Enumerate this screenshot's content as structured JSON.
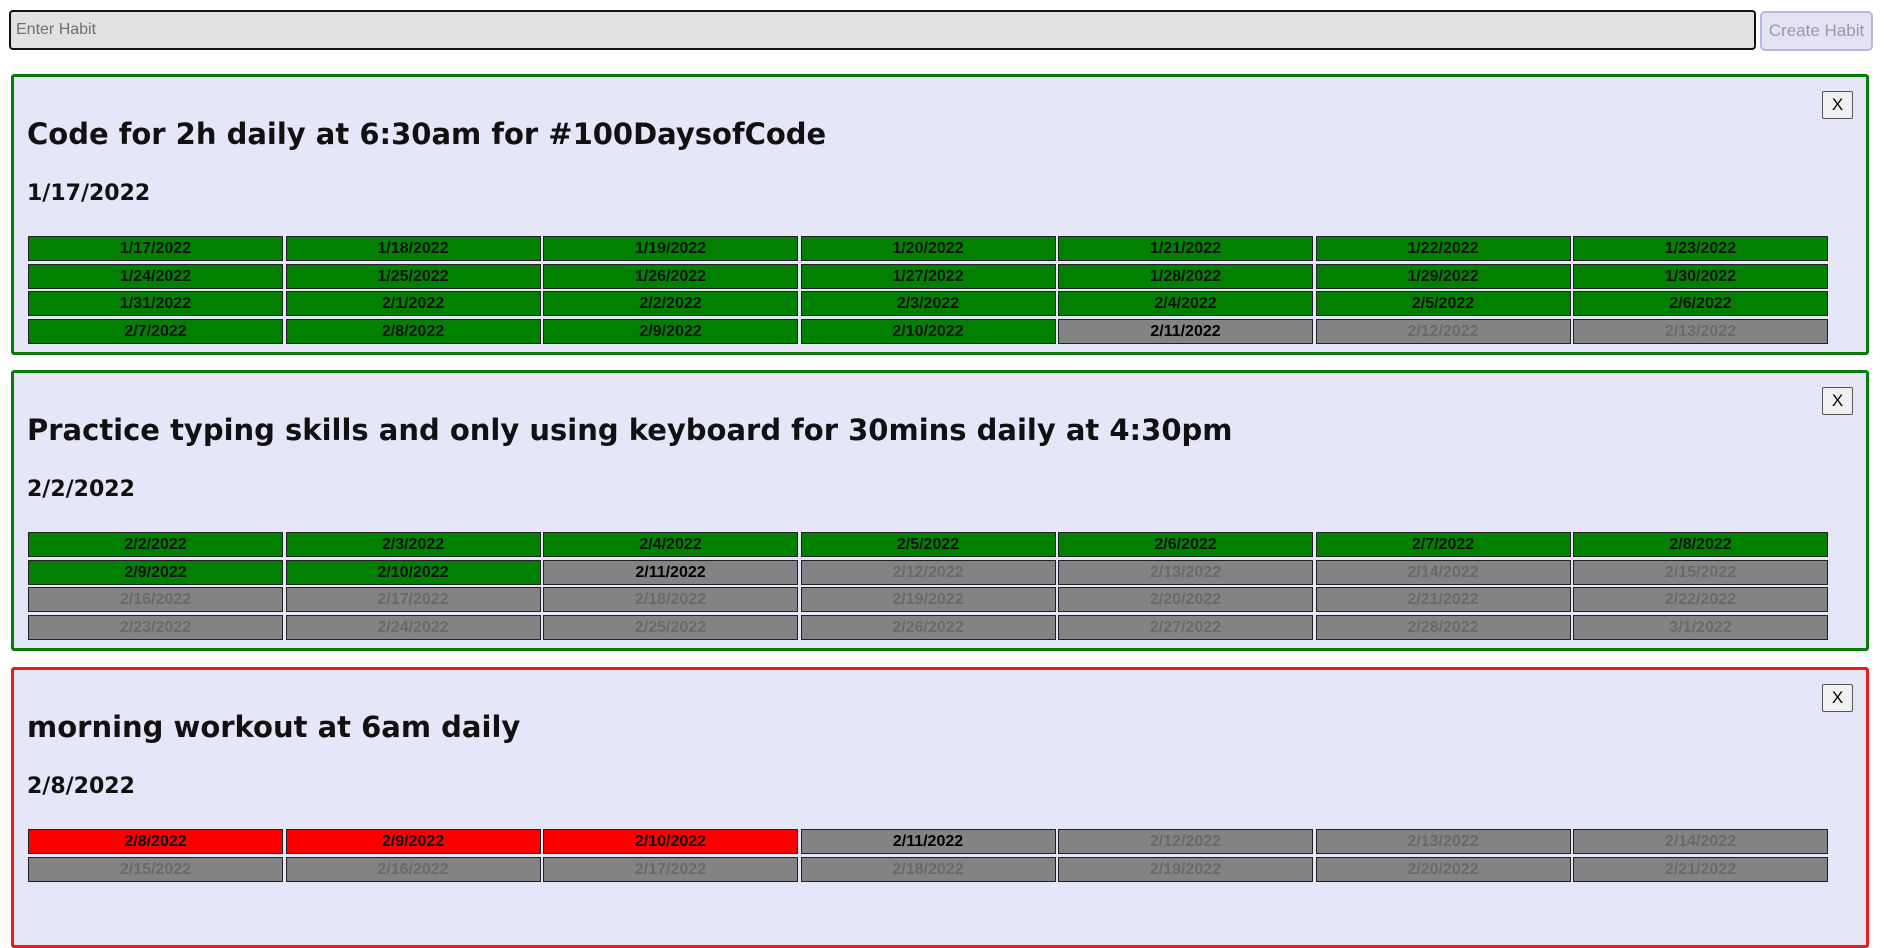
{
  "new_habit": {
    "placeholder": "Enter Habit",
    "value": "",
    "create_label": "Create Habit"
  },
  "colors": {
    "done": "#028002",
    "missed": "#fc0000",
    "pending": "#838383",
    "card_bg": "#e6e6f9",
    "border_good": "#0a7a0a",
    "border_bad": "#ef1b1b"
  },
  "habits": [
    {
      "title": "Code for 2h daily at 6:30am for #100DaysofCode",
      "start_date": "1/17/2022",
      "close_label": "X",
      "status": "good",
      "days": [
        {
          "date": "1/17/2022",
          "status": "done"
        },
        {
          "date": "1/18/2022",
          "status": "done"
        },
        {
          "date": "1/19/2022",
          "status": "done"
        },
        {
          "date": "1/20/2022",
          "status": "done"
        },
        {
          "date": "1/21/2022",
          "status": "done"
        },
        {
          "date": "1/22/2022",
          "status": "done"
        },
        {
          "date": "1/23/2022",
          "status": "done"
        },
        {
          "date": "1/24/2022",
          "status": "done"
        },
        {
          "date": "1/25/2022",
          "status": "done"
        },
        {
          "date": "1/26/2022",
          "status": "done"
        },
        {
          "date": "1/27/2022",
          "status": "done"
        },
        {
          "date": "1/28/2022",
          "status": "done"
        },
        {
          "date": "1/29/2022",
          "status": "done"
        },
        {
          "date": "1/30/2022",
          "status": "done"
        },
        {
          "date": "1/31/2022",
          "status": "done"
        },
        {
          "date": "2/1/2022",
          "status": "done"
        },
        {
          "date": "2/2/2022",
          "status": "done"
        },
        {
          "date": "2/3/2022",
          "status": "done"
        },
        {
          "date": "2/4/2022",
          "status": "done"
        },
        {
          "date": "2/5/2022",
          "status": "done"
        },
        {
          "date": "2/6/2022",
          "status": "done"
        },
        {
          "date": "2/7/2022",
          "status": "done"
        },
        {
          "date": "2/8/2022",
          "status": "done"
        },
        {
          "date": "2/9/2022",
          "status": "done"
        },
        {
          "date": "2/10/2022",
          "status": "done"
        },
        {
          "date": "2/11/2022",
          "status": "today"
        },
        {
          "date": "2/12/2022",
          "status": "future"
        },
        {
          "date": "2/13/2022",
          "status": "future"
        }
      ]
    },
    {
      "title": "Practice typing skills and only using keyboard for 30mins daily at 4:30pm",
      "start_date": "2/2/2022",
      "close_label": "X",
      "status": "good",
      "days": [
        {
          "date": "2/2/2022",
          "status": "done"
        },
        {
          "date": "2/3/2022",
          "status": "done"
        },
        {
          "date": "2/4/2022",
          "status": "done"
        },
        {
          "date": "2/5/2022",
          "status": "done"
        },
        {
          "date": "2/6/2022",
          "status": "done"
        },
        {
          "date": "2/7/2022",
          "status": "done"
        },
        {
          "date": "2/8/2022",
          "status": "done"
        },
        {
          "date": "2/9/2022",
          "status": "done"
        },
        {
          "date": "2/10/2022",
          "status": "done"
        },
        {
          "date": "2/11/2022",
          "status": "today"
        },
        {
          "date": "2/12/2022",
          "status": "future"
        },
        {
          "date": "2/13/2022",
          "status": "future"
        },
        {
          "date": "2/14/2022",
          "status": "future"
        },
        {
          "date": "2/15/2022",
          "status": "future"
        },
        {
          "date": "2/16/2022",
          "status": "future"
        },
        {
          "date": "2/17/2022",
          "status": "future"
        },
        {
          "date": "2/18/2022",
          "status": "future"
        },
        {
          "date": "2/19/2022",
          "status": "future"
        },
        {
          "date": "2/20/2022",
          "status": "future"
        },
        {
          "date": "2/21/2022",
          "status": "future"
        },
        {
          "date": "2/22/2022",
          "status": "future"
        },
        {
          "date": "2/23/2022",
          "status": "future"
        },
        {
          "date": "2/24/2022",
          "status": "future"
        },
        {
          "date": "2/25/2022",
          "status": "future"
        },
        {
          "date": "2/26/2022",
          "status": "future"
        },
        {
          "date": "2/27/2022",
          "status": "future"
        },
        {
          "date": "2/28/2022",
          "status": "future"
        },
        {
          "date": "3/1/2022",
          "status": "future"
        }
      ]
    },
    {
      "title": "morning workout at 6am daily",
      "start_date": "2/8/2022",
      "close_label": "X",
      "status": "bad",
      "days": [
        {
          "date": "2/8/2022",
          "status": "missed"
        },
        {
          "date": "2/9/2022",
          "status": "missed"
        },
        {
          "date": "2/10/2022",
          "status": "missed"
        },
        {
          "date": "2/11/2022",
          "status": "today"
        },
        {
          "date": "2/12/2022",
          "status": "future"
        },
        {
          "date": "2/13/2022",
          "status": "future"
        },
        {
          "date": "2/14/2022",
          "status": "future"
        },
        {
          "date": "2/15/2022",
          "status": "future"
        },
        {
          "date": "2/16/2022",
          "status": "future"
        },
        {
          "date": "2/17/2022",
          "status": "future"
        },
        {
          "date": "2/18/2022",
          "status": "future"
        },
        {
          "date": "2/19/2022",
          "status": "future"
        },
        {
          "date": "2/20/2022",
          "status": "future"
        },
        {
          "date": "2/21/2022",
          "status": "future"
        }
      ]
    }
  ]
}
